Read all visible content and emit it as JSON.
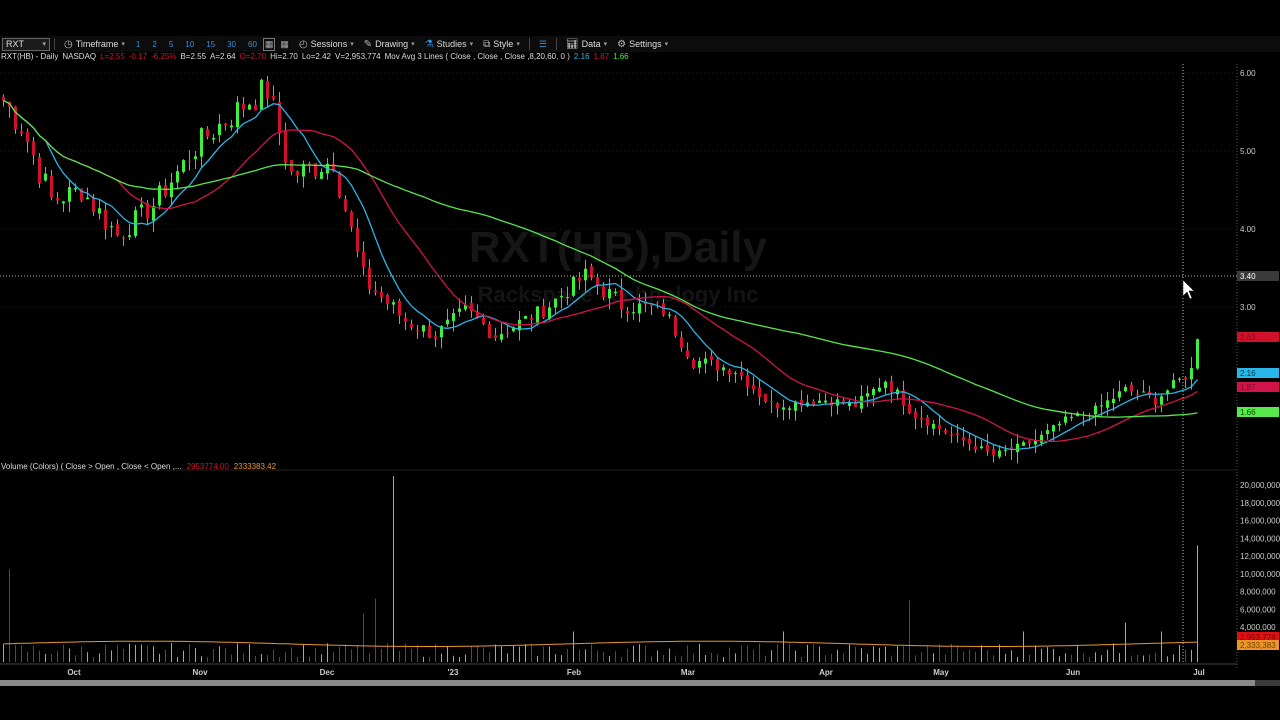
{
  "toolbar": {
    "symbol": "RXT",
    "timeframe": "Timeframe",
    "intervals": [
      "1",
      "2",
      "5",
      "10",
      "15",
      "30",
      "60"
    ],
    "sessions": "Sessions",
    "drawing": "Drawing",
    "studies": "Studies",
    "style": "Style",
    "data": "Data",
    "settings": "Settings"
  },
  "info": {
    "title": "RXT(HB) - Daily",
    "exchange": "NASDAQ",
    "last": "L=2.55",
    "change": "-0.17",
    "change_pct": "-6.25%",
    "bid": "B=2.55",
    "ask": "A=2.64",
    "open": "O=2.70",
    "high": "Hi=2.70",
    "low": "Lo=2.42",
    "volume": "V=2,953,774",
    "study": "Mov Avg 3 Lines ( Close , Close , Close ,8,20,60, 0 )",
    "ma1": "2.16",
    "ma2": "1.87",
    "ma3": "1.66"
  },
  "watermark": {
    "title": "RXT(HB),Daily",
    "subtitle": "Rackspace Technology Inc"
  },
  "volume_header": {
    "label": "Volume (Colors) ( Close > Open , Close < Open ,...",
    "v1": "2953774.00",
    "v2": "2333383.42"
  },
  "price_axis": {
    "ticks": [
      "6.00",
      "5.00",
      "4.00",
      "3.00"
    ],
    "crosshair": "3.40",
    "last_label": "2.63",
    "ma_labels": [
      "2.16",
      "1.87",
      "1.66"
    ]
  },
  "volume_axis": {
    "ticks": [
      "20,000,000",
      "18,000,000",
      "16,000,000",
      "14,000,000",
      "12,000,000",
      "10,000,000",
      "8,000,000",
      "6,000,000",
      "4,000,000"
    ],
    "last_label": "2,953,774",
    "avg_label": "2,333,383"
  },
  "x_axis": [
    "Oct",
    "Nov",
    "Dec",
    "'23",
    "Feb",
    "Mar",
    "Apr",
    "May",
    "Jun",
    "Jul"
  ],
  "colors": {
    "up": "#3cf03c",
    "down": "#d0112b",
    "ma8": "#29b6e8",
    "ma20": "#d0144a",
    "ma60": "#57e84a",
    "vol_avg": "#e8962a"
  },
  "chart_data": {
    "type": "candlestick",
    "price_range": [
      1.0,
      6.1
    ],
    "close_keypoints": [
      [
        0,
        5.65
      ],
      [
        3,
        5.33
      ],
      [
        8,
        4.37
      ],
      [
        13,
        4.5
      ],
      [
        19,
        3.92
      ],
      [
        25,
        4.31
      ],
      [
        33,
        5.14
      ],
      [
        41,
        5.65
      ],
      [
        44,
        5.78
      ],
      [
        48,
        4.69
      ],
      [
        55,
        4.88
      ],
      [
        60,
        3.35
      ],
      [
        67,
        2.83
      ],
      [
        72,
        2.64
      ],
      [
        77,
        2.96
      ],
      [
        82,
        2.64
      ],
      [
        90,
        2.96
      ],
      [
        97,
        3.41
      ],
      [
        103,
        3.03
      ],
      [
        110,
        2.96
      ],
      [
        115,
        2.32
      ],
      [
        122,
        2.19
      ],
      [
        128,
        1.74
      ],
      [
        137,
        1.81
      ],
      [
        142,
        1.74
      ],
      [
        147,
        2.06
      ],
      [
        152,
        1.62
      ],
      [
        158,
        1.36
      ],
      [
        165,
        1.1
      ],
      [
        172,
        1.29
      ],
      [
        177,
        1.55
      ],
      [
        182,
        1.68
      ],
      [
        187,
        1.94
      ],
      [
        192,
        1.81
      ],
      [
        196,
        2.06
      ],
      [
        198,
        2.19
      ],
      [
        199,
        2.64
      ]
    ],
    "volume_spikes": [
      [
        1,
        10.5
      ],
      [
        60,
        5.5
      ],
      [
        62,
        7.2
      ],
      [
        65,
        21
      ],
      [
        95,
        3.5
      ],
      [
        130,
        3.5
      ],
      [
        151,
        7.0
      ],
      [
        170,
        3.5
      ],
      [
        187,
        4.5
      ],
      [
        193,
        3.5
      ],
      [
        199,
        13.2
      ]
    ]
  }
}
